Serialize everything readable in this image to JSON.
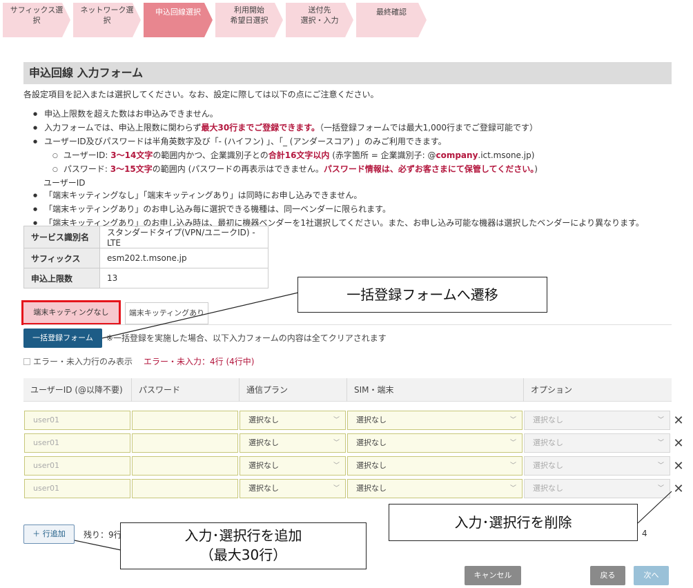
{
  "steps": [
    {
      "label": "サフィックス選\n択"
    },
    {
      "label": "ネットワーク選\n択"
    },
    {
      "label": "申込回線選択"
    },
    {
      "label": "利用開始\n希望日選択"
    },
    {
      "label": "送付先\n選択・入力"
    },
    {
      "label": "最終確認"
    }
  ],
  "page": {
    "title": "申込回線 入力フォーム",
    "intro": "各設定項目を記入または選択してください。なお、設定に際しては以下の点にご注意ください。"
  },
  "notes": {
    "n1": "申込上限数を超えた数はお申込みできません。",
    "n2a": "入力フォームでは、申込上限数に関わらず",
    "n2b": "最大30行までご登録できます。",
    "n2c": "（一括登録フォームでは最大1,000行までご登録可能です）",
    "n3": "ユーザーID及びパスワードは半角英数字及び「- (ハイフン) 」、「_ (アンダースコア) 」のみご利用できます。",
    "s1a": "ユーザーID: ",
    "s1b": "3～14文字",
    "s1c": "の範囲内かつ、企業識別子との",
    "s1d": "合計16文字以内",
    "s1e": " (赤字箇所 = 企業識別子: @",
    "s1f": "company",
    "s1g": ".ict.msone.jp)",
    "s2a": "パスワード: ",
    "s2b": "3～15文字",
    "s2c": "の範囲内 (パスワードの再表示はできません。",
    "s2d": "パスワード情報は、必ずお客さまにて保管してください。",
    "s2e": ")",
    "p1": "ユーザーID",
    "n4": "「端末キッティングなし」「端末キッティングあり」は同時にお申し込みできません。",
    "n5": "「端末キッティングあり」のお申し込み毎に選択できる機種は、同一ベンダーに限られます。",
    "n6": "「端末キッティングあり」のお申し込み時は、最初に機器ベンダーを1社選択してください。また、お申し込み可能な機器は選択したベンダーにより異なります。"
  },
  "info": {
    "service_key": "サービス識別名",
    "service_val": "スタンダードタイプ(VPN/ユニークID) - LTE",
    "suffix_key": "サフィックス",
    "suffix_val": "esm202.t.msone.jp",
    "limit_key": "申込上限数",
    "limit_val": "13"
  },
  "tabs": {
    "tab1": "端末キッティングなし",
    "tab2": "端末キッティングあり"
  },
  "bulk": {
    "button": "一括登録フォーム",
    "note": "※一括登録を実施した場合、以下入力フォームの内容は全てクリアされます"
  },
  "filter": {
    "label": "エラー・未入力行のみ表示",
    "error": "エラー・未入力：4行 (4行中)"
  },
  "columns": {
    "userid": "ユーザーID (@以降不要)",
    "password": "パスワード",
    "plan": "通信プラン",
    "sim": "SIM・端末",
    "option": "オプション"
  },
  "rows": [
    {
      "user_ph": "user01",
      "plan": "選択なし",
      "sim": "選択なし",
      "option": "選択なし"
    },
    {
      "user_ph": "user01",
      "plan": "選択なし",
      "sim": "選択なし",
      "option": "選択なし"
    },
    {
      "user_ph": "user01",
      "plan": "選択なし",
      "sim": "選択なし",
      "option": "選択なし"
    },
    {
      "user_ph": "user01",
      "plan": "選択なし",
      "sim": "選択なし",
      "option": "選択なし"
    }
  ],
  "footer": {
    "add_row": "＋ 行追加",
    "remaining": "残り：9行",
    "count_tail": "4",
    "cancel": "キャンセル",
    "back": "戻る",
    "next": "次へ"
  },
  "callouts": {
    "bulk_form": "一括登録フォームへ遷移",
    "delete_row": "入力･選択行を削除",
    "add_row": "入力･選択行を追加\n（最大30行）"
  },
  "icons": {
    "delete": "close-icon",
    "chevron": "chevron-down-icon"
  },
  "colors": {
    "active_step": "#e8868f",
    "step": "#f8d7dc",
    "primary": "#1d5c86",
    "error": "#b3163d",
    "highlight": "#e5141b"
  }
}
